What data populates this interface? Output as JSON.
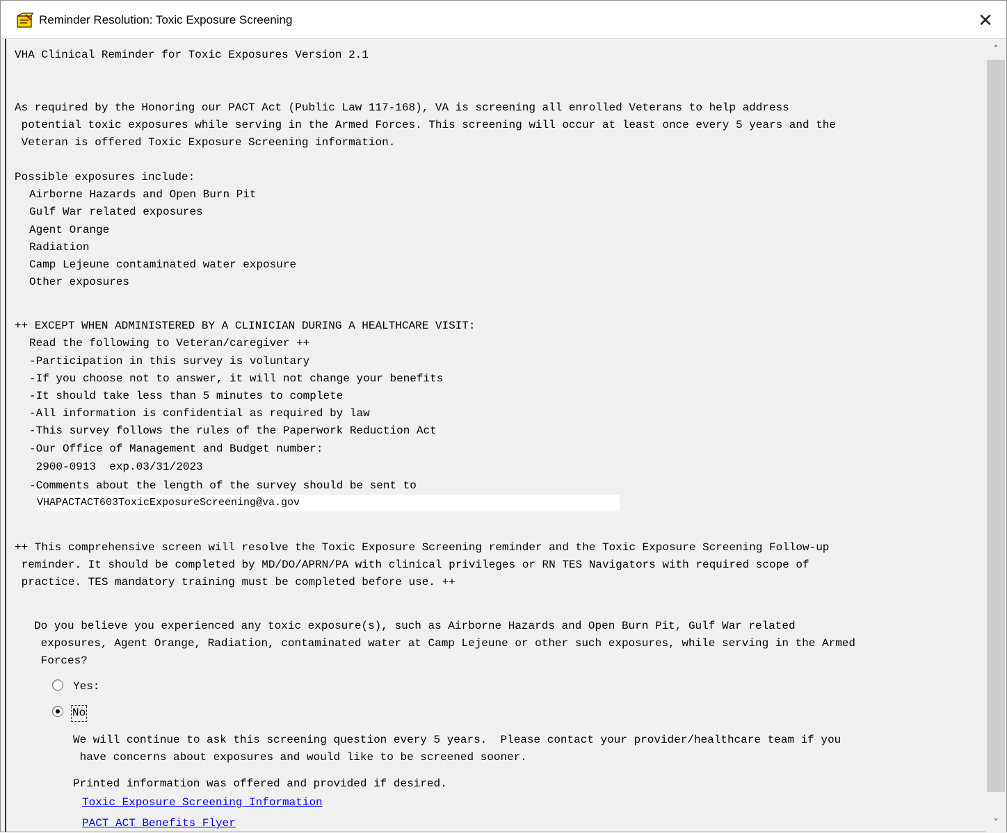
{
  "window": {
    "title": "Reminder Resolution: Toxic Exposure Screening",
    "close_label": "✕"
  },
  "content": {
    "heading": "VHA Clinical Reminder for Toxic Exposures Version 2.1",
    "intro_lines": [
      "As required by the Honoring our PACT Act (Public Law 117-168), VA is screening all enrolled Veterans to help address",
      " potential toxic exposures while serving in the Armed Forces. This screening will occur at least once every 5 years and the",
      " Veteran is offered Toxic Exposure Screening information."
    ],
    "exposures_header": "Possible exposures include:",
    "exposures": [
      "Airborne Hazards and Open Burn Pit",
      "Gulf War related exposures",
      "Agent Orange",
      "Radiation",
      "Camp Lejeune contaminated water exposure",
      "Other exposures"
    ],
    "except_header": "++ EXCEPT WHEN ADMINISTERED BY A CLINICIAN DURING A HEALTHCARE VISIT:",
    "read_lines": [
      "Read the following to Veteran/caregiver ++",
      "-Participation in this survey is voluntary",
      "-If you choose not to answer, it will not change your benefits",
      "-It should take less than 5 minutes to complete",
      "-All information is confidential as required by law",
      "-This survey follows the rules of the Paperwork Reduction Act",
      "-Our Office of Management and Budget number:",
      " 2900-0913  exp.03/31/2023",
      "-Comments about the length of the survey should be sent to"
    ],
    "email": "VHAPACTACT603ToxicExposureScreening@va.gov",
    "comprehensive_lines": [
      "++ This comprehensive screen will resolve the Toxic Exposure Screening reminder and the Toxic Exposure Screening Follow-up",
      " reminder. It should be completed by MD/DO/APRN/PA with clinical privileges or RN TES Navigators with required scope of",
      " practice. TES mandatory training must be completed before use. ++"
    ],
    "question_lines": [
      "Do you believe you experienced any toxic exposure(s), such as Airborne Hazards and Open Burn Pit, Gulf War related",
      " exposures, Agent Orange, Radiation, contaminated water at Camp Lejeune or other such exposures, while serving in the Armed",
      " Forces?"
    ],
    "options": {
      "yes_label": "Yes:",
      "no_label": "No",
      "selected": "No"
    },
    "no_detail_lines": [
      "We will continue to ask this screening question every 5 years.  Please contact your provider/healthcare team if you",
      " have concerns about exposures and would like to be screened sooner."
    ],
    "printed_info": "Printed information was offered and provided if desired.",
    "links": [
      "Toxic Exposure Screening Information",
      "PACT ACT Benefits Flyer"
    ]
  },
  "scrollbar": {
    "up_icon": "chevron-up-icon",
    "down_icon": "chevron-down-icon"
  }
}
